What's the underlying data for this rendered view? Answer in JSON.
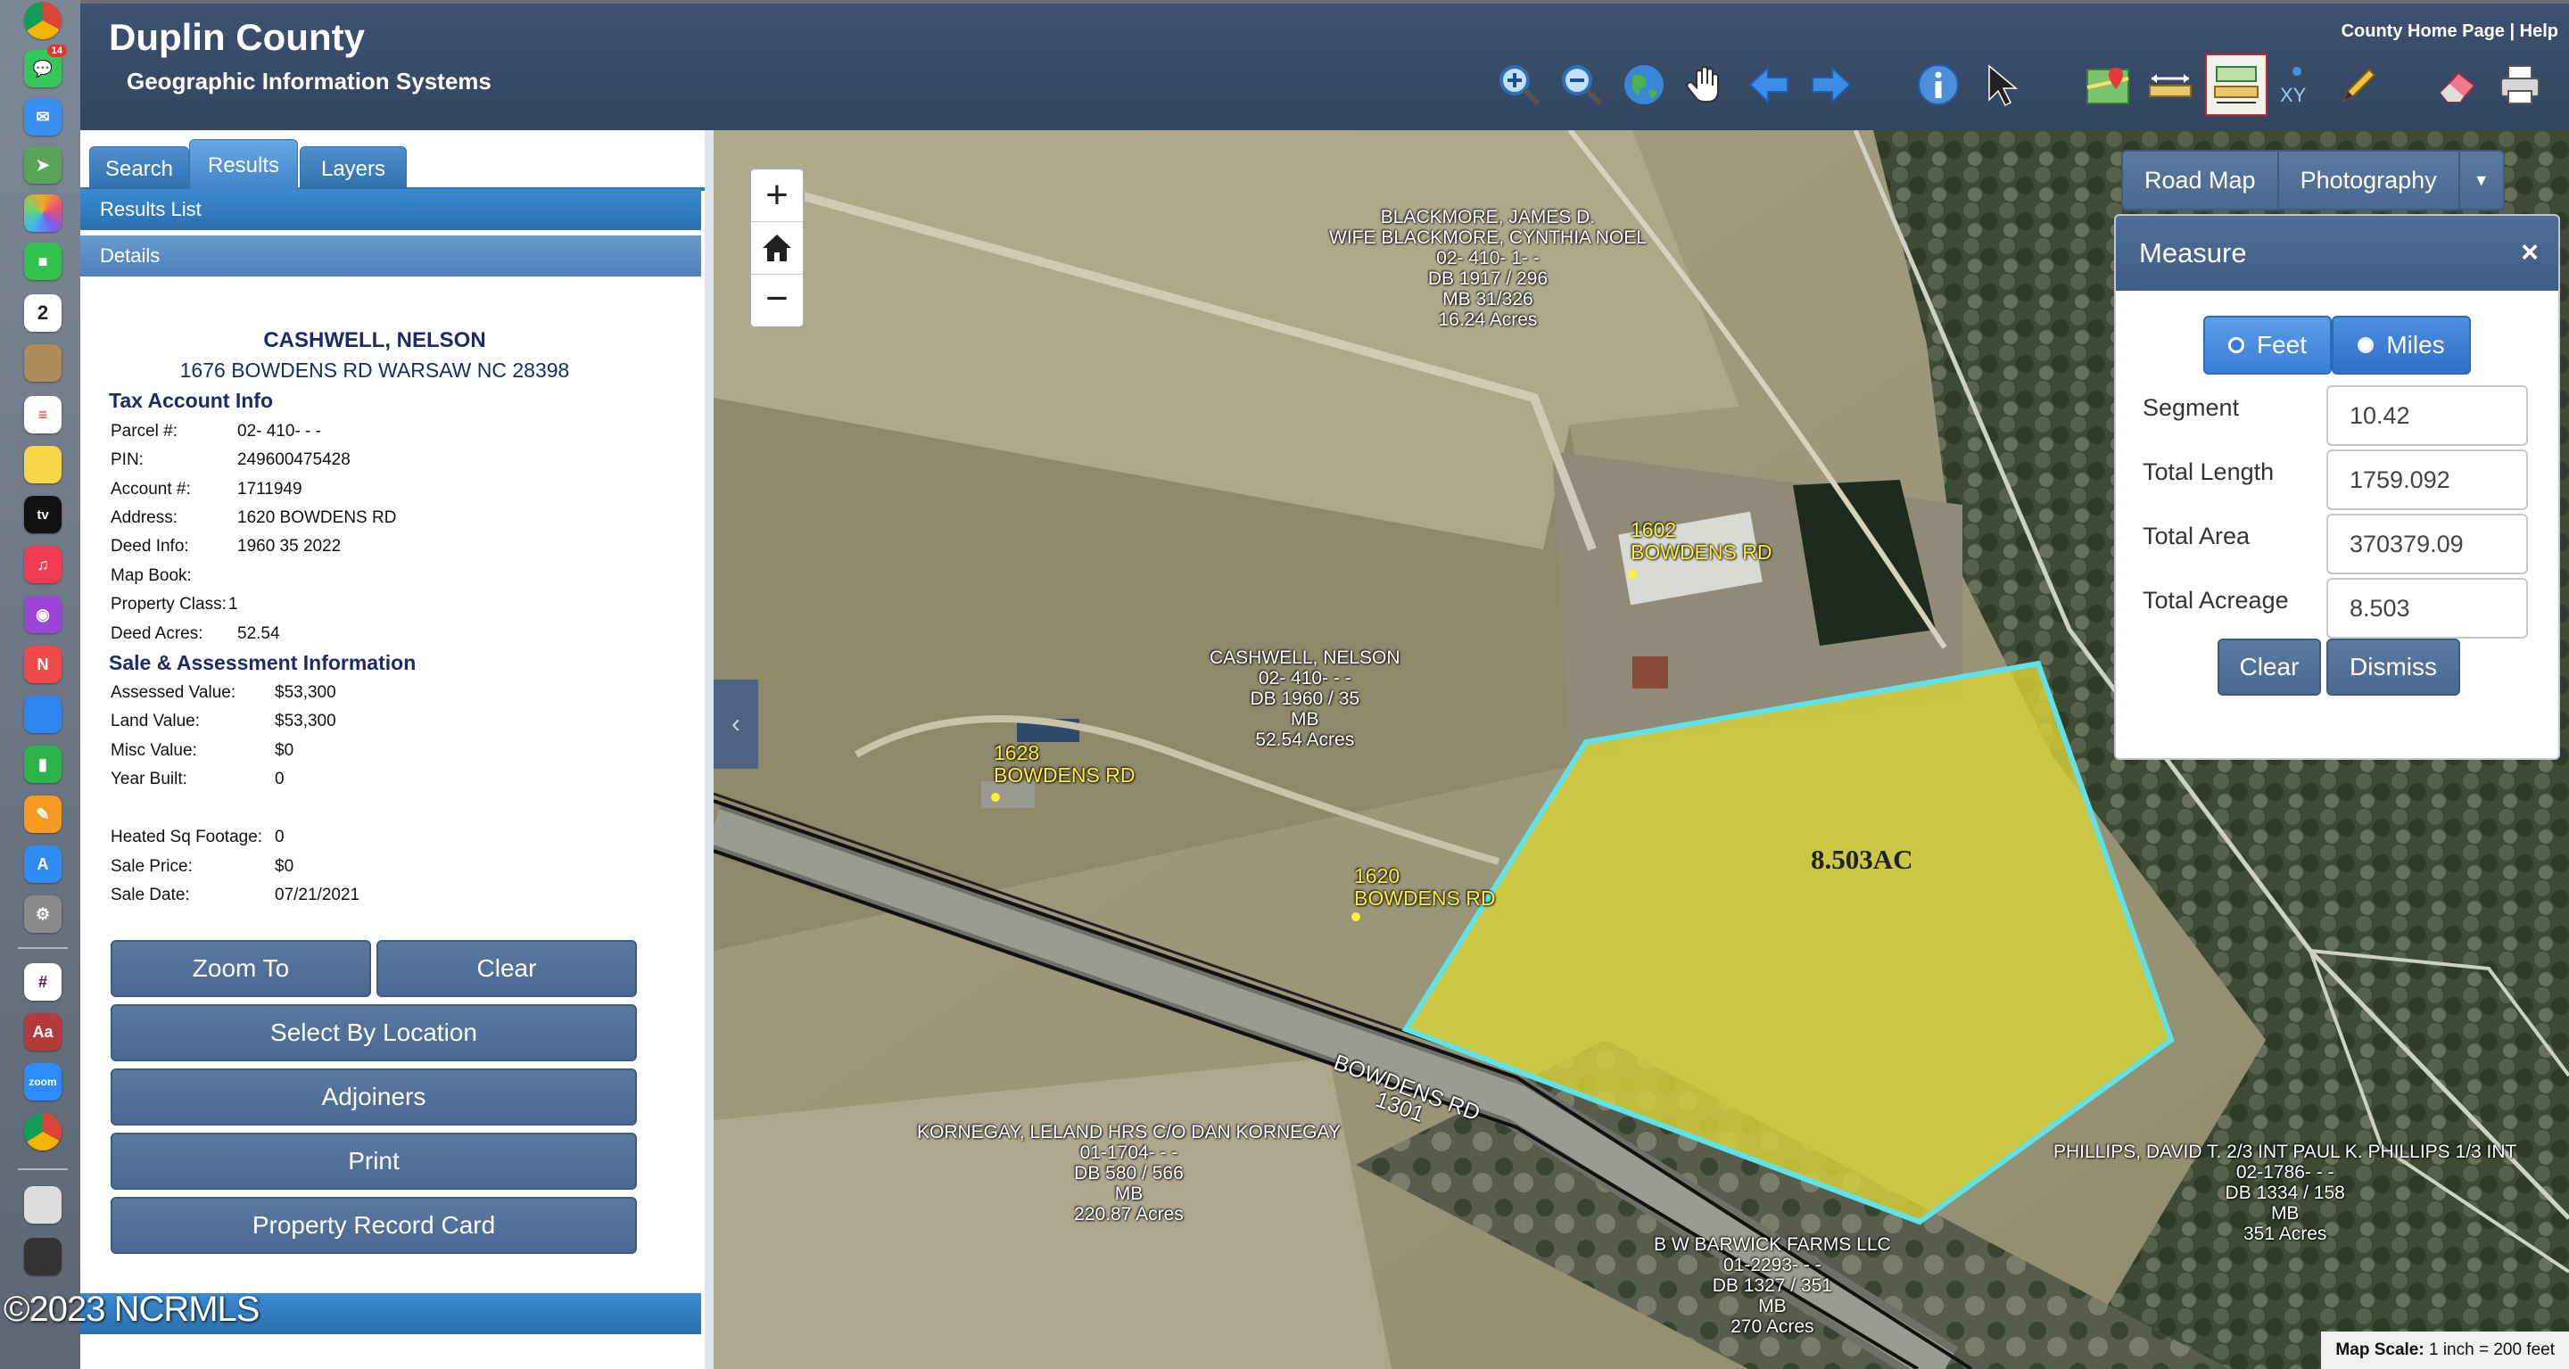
{
  "header": {
    "title": "Duplin County",
    "subtitle": "Geographic Information Systems",
    "link_home": "County Home Page",
    "link_sep": "|",
    "link_help": "Help"
  },
  "tabs": [
    {
      "label": "Search"
    },
    {
      "label": "Results"
    },
    {
      "label": "Layers"
    }
  ],
  "results_list_label": "Results List",
  "details_label": "Details",
  "details": {
    "owner": "CASHWELL, NELSON",
    "address_line": "1676 BOWDENS RD WARSAW NC 28398",
    "tax_title": "Tax Account Info",
    "tax_rows": [
      {
        "k": "Parcel #:",
        "v": "02- 410- - -"
      },
      {
        "k": "PIN:",
        "v": "249600475428"
      },
      {
        "k": "Account #:",
        "v": "1711949"
      },
      {
        "k": "Address:",
        "v": "1620 BOWDENS RD"
      },
      {
        "k": "Deed Info:",
        "v": "1960 35 2022"
      },
      {
        "k": "Map Book:",
        "v": ""
      },
      {
        "k": "Property Class:",
        "v": "1"
      },
      {
        "k": "Deed Acres:",
        "v": "52.54"
      }
    ],
    "sale_title": "Sale & Assessment Information",
    "sale_rows": [
      {
        "k": "Assessed Value:",
        "v": "$53,300"
      },
      {
        "k": "Land Value:",
        "v": "$53,300"
      },
      {
        "k": "Misc Value:",
        "v": "$0"
      },
      {
        "k": "Year Built:",
        "v": "0"
      },
      {
        "k": "Heated Sq Footage:",
        "v": "0"
      },
      {
        "k": "Sale Price:",
        "v": "$0"
      },
      {
        "k": "Sale Date:",
        "v": "07/21/2021"
      }
    ]
  },
  "buttons": {
    "zoom_to": "Zoom To",
    "clear": "Clear",
    "select_by_location": "Select By Location",
    "adjoiners": "Adjoiners",
    "print": "Print",
    "property_record_card": "Property Record Card"
  },
  "map": {
    "basemap_road": "Road Map",
    "basemap_photo": "Photography",
    "scale_label": "Map Scale:",
    "scale_value": "1 inch = 200 feet",
    "polygon_label": "8.503AC",
    "road_name": "BOWDENS RD",
    "road_number": "1301",
    "parcels": [
      {
        "lines": [
          "BLACKMORE, JAMES D.",
          "WIFE BLACKMORE, CYNTHIA NOEL",
          "02- 410- 1- -",
          "DB 1917 / 296",
          "MB 31/326",
          "16.24 Acres"
        ]
      },
      {
        "lines": [
          "CASHWELL, NELSON",
          "02- 410- - -",
          "DB 1960 / 35",
          "MB",
          "52.54 Acres"
        ]
      },
      {
        "lines": [
          "KORNEGAY, LELAND HRS C/O DAN KORNEGAY",
          "01-1704- - -",
          "DB 580 / 566",
          "MB",
          "220.87 Acres"
        ]
      },
      {
        "lines": [
          "PHILLIPS, DAVID T. 2/3 INT PAUL K. PHILLIPS 1/3 INT",
          "02-1786- - -",
          "DB 1334 / 158",
          "MB",
          "351 Acres"
        ]
      },
      {
        "lines": [
          "B W BARWICK FARMS LLC",
          "01-2293- - -",
          "DB 1327 / 351",
          "MB",
          "270 Acres"
        ]
      }
    ],
    "addresses": [
      {
        "num": "1602",
        "street": "BOWDENS RD"
      },
      {
        "num": "1628",
        "street": "BOWDENS RD"
      },
      {
        "num": "1620",
        "street": "BOWDENS RD"
      }
    ]
  },
  "measure": {
    "title": "Measure",
    "close": "×",
    "unit_feet": "Feet",
    "unit_miles": "Miles",
    "rows": [
      {
        "label": "Segment",
        "value": "10.42"
      },
      {
        "label": "Total Length",
        "value": "1759.092"
      },
      {
        "label": "Total Area",
        "value": "370379.09"
      },
      {
        "label": "Total Acreage",
        "value": "8.503"
      }
    ],
    "clear_label": "Clear",
    "dismiss_label": "Dismiss"
  },
  "watermark": "©2023 NCRMLS",
  "colors": {
    "header_bg": "#3d5270",
    "tab_blue": "#3f82c8",
    "button_slate": "#4a6890",
    "polygon_fill": "#d8d23a",
    "polygon_stroke": "#5fe3e8"
  }
}
